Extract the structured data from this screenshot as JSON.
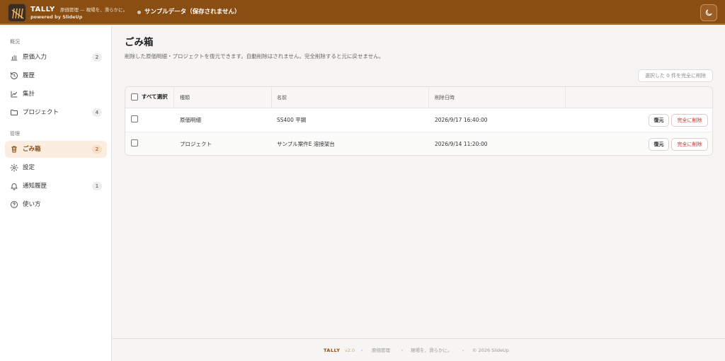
{
  "header": {
    "brand": "TALLY",
    "tagline": "原価管理 — 現場を、滑らかに。",
    "powered": "powered by SlideUp",
    "sample_label": "サンプルデータ（保存されません）",
    "theme_icon": "moon-icon"
  },
  "sidebar": {
    "section_overview": "概況",
    "section_manage": "管理",
    "items": [
      {
        "label": "原価入力",
        "count": "2",
        "icon": "bar-chart-icon"
      },
      {
        "label": "履歴",
        "icon": "history-icon"
      },
      {
        "label": "集計",
        "icon": "line-chart-icon"
      },
      {
        "label": "プロジェクト",
        "count": "4",
        "icon": "folder-icon"
      },
      {
        "label": "ごみ箱",
        "count": "2",
        "icon": "trash-icon",
        "active": true
      },
      {
        "label": "設定",
        "icon": "gear-icon"
      },
      {
        "label": "通知履歴",
        "count": "1",
        "icon": "bell-icon"
      },
      {
        "label": "使い方",
        "icon": "help-circle-icon"
      }
    ]
  },
  "main": {
    "title": "ごみ箱",
    "description": "削除した原価明細・プロジェクトを復元できます。自動削除はされません。完全削除すると元に戻せません。",
    "bulk_delete_label": "選択した 0 件を完全に削除",
    "table": {
      "select_all_label": "すべて選択",
      "headers": {
        "type": "種類",
        "name": "名前",
        "deleted_at": "削除日時"
      },
      "rows": [
        {
          "type": "原価明細",
          "name": "SS400 平鋼",
          "deleted_at": "2026/9/17 16:40:00",
          "restore_label": "復元",
          "purge_label": "完全に削除"
        },
        {
          "type": "プロジェクト",
          "name": "サンプル案件E 溶接架台",
          "deleted_at": "2026/9/14 11:20:00",
          "restore_label": "復元",
          "purge_label": "完全に削除"
        }
      ]
    }
  },
  "footer": {
    "brand": "TALLY",
    "version": "v2.0",
    "product": "原価管理",
    "slogan": "現場を、滑らかに。",
    "copyright": "© 2026 SlideUp"
  },
  "colors": {
    "header_bg": "#8a4d12",
    "accent": "#b06a1c",
    "active_bg": "#fbeee0",
    "danger": "#c73030"
  }
}
